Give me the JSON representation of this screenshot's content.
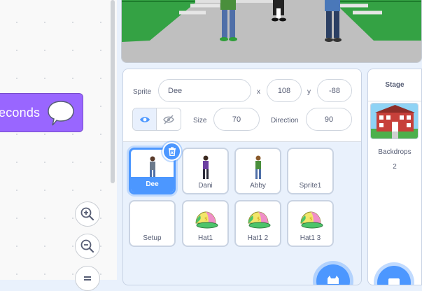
{
  "code_area": {
    "say_block_text": "econds"
  },
  "sprite_info": {
    "sprite_label": "Sprite",
    "sprite_name": "Dee",
    "x_label": "x",
    "x_value": "108",
    "y_label": "y",
    "y_value": "-88",
    "size_label": "Size",
    "size_value": "70",
    "direction_label": "Direction",
    "direction_value": "90"
  },
  "sprites": [
    {
      "name": "Dee",
      "selected": true,
      "icon": "person-dee-icon"
    },
    {
      "name": "Dani",
      "icon": "person-dani-icon"
    },
    {
      "name": "Abby",
      "icon": "person-abby-icon"
    },
    {
      "name": "Sprite1",
      "icon": "empty"
    },
    {
      "name": "Setup",
      "icon": "empty"
    },
    {
      "name": "Hat1",
      "icon": "cap-icon"
    },
    {
      "name": "Hat1 2",
      "icon": "cap-icon"
    },
    {
      "name": "Hat1 3",
      "icon": "cap-icon"
    }
  ],
  "stage_pane": {
    "title": "Stage",
    "backdrops_label": "Backdrops",
    "backdrops_count": "2"
  },
  "colors": {
    "accent": "#4c97ff",
    "looks_block": "#9966ff",
    "text": "#575e75"
  }
}
